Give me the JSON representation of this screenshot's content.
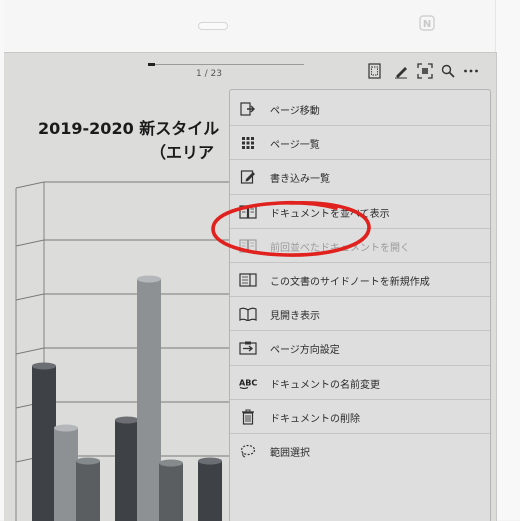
{
  "device": {
    "nfc_mark": "N"
  },
  "toolbar": {
    "page_indicator": "1 / 23",
    "page_progress": 0.045,
    "icons": [
      "page-list-icon",
      "pen-icon",
      "fit-screen-icon",
      "search-icon",
      "more-options-icon"
    ]
  },
  "document": {
    "title": "2019-2020 新スタイル",
    "subtitle": "（エリア"
  },
  "menu": {
    "items": [
      {
        "label": "ページ移動",
        "icon": "page-jump-icon",
        "enabled": true
      },
      {
        "label": "ページ一覧",
        "icon": "page-grid-icon",
        "enabled": true
      },
      {
        "label": "書き込み一覧",
        "icon": "annotation-list-icon",
        "enabled": true
      },
      {
        "label": "ドキュメントを並べて表示",
        "icon": "side-by-side-icon",
        "enabled": true
      },
      {
        "label": "前回並べたドキュメントを開く",
        "icon": "previous-side-by-side-icon",
        "enabled": false
      },
      {
        "label": "この文書のサイドノートを新規作成",
        "icon": "side-note-icon",
        "enabled": true
      },
      {
        "label": "見開き表示",
        "icon": "spread-view-icon",
        "enabled": true
      },
      {
        "label": "ページ方向設定",
        "icon": "page-orientation-icon",
        "enabled": true
      },
      {
        "label": "ドキュメントの名前変更",
        "icon": "rename-abc-icon",
        "enabled": true
      },
      {
        "label": "ドキュメントの削除",
        "icon": "trash-icon",
        "enabled": true
      },
      {
        "label": "範囲選択",
        "icon": "lasso-select-icon",
        "enabled": true
      }
    ]
  },
  "colors": {
    "highlight": "#e0211d",
    "screen": "#dcdcda",
    "menu": "#dedede"
  }
}
